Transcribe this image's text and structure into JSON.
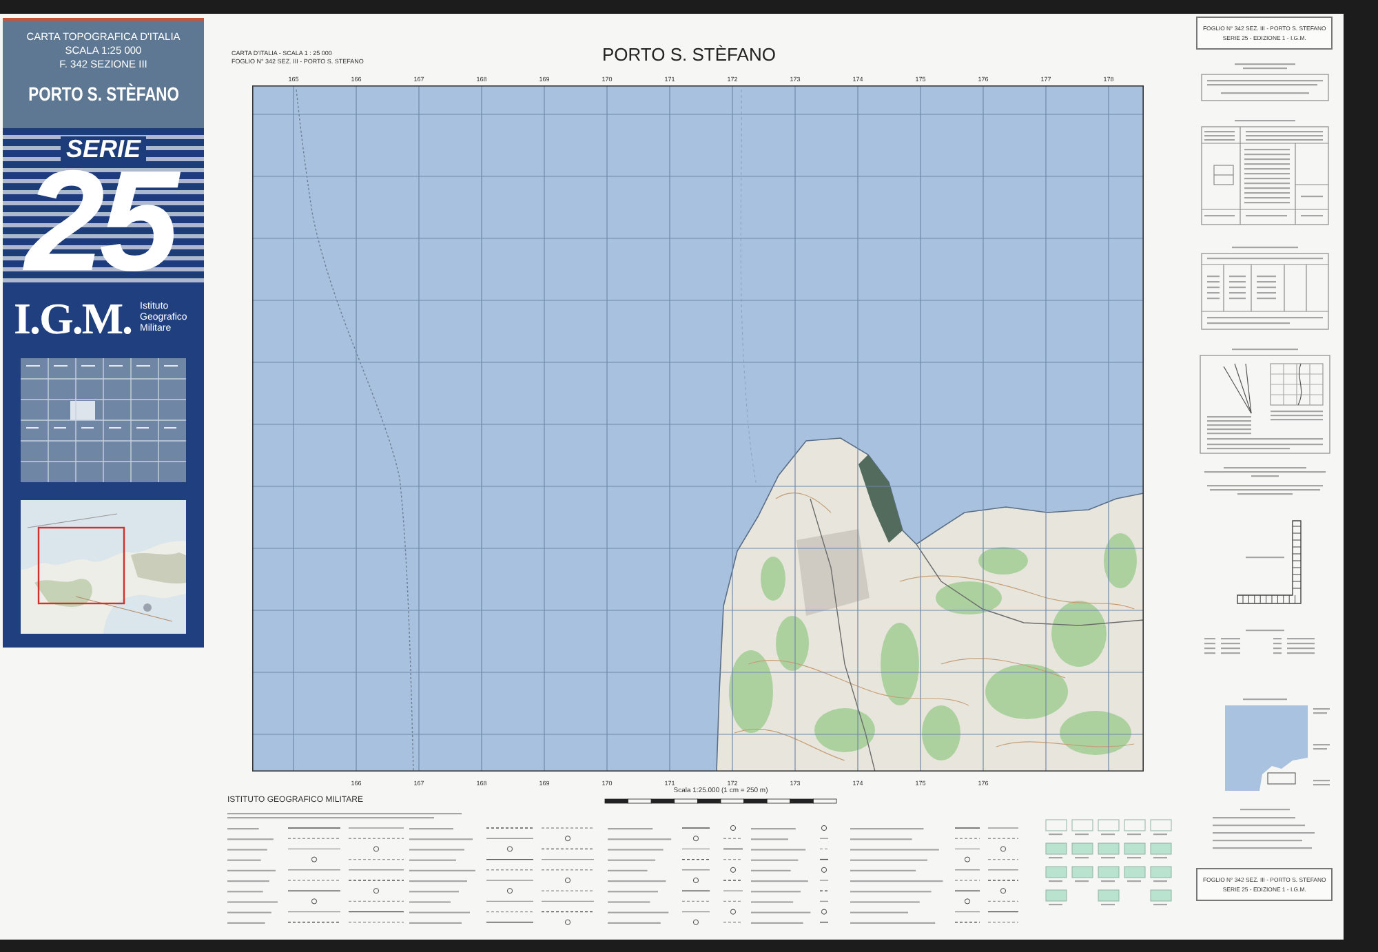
{
  "cover": {
    "heading": "CARTA TOPOGRAFICA D'ITALIA",
    "scale": "SCALA 1:25 000",
    "sheet": "F. 342 SEZIONE III",
    "place": "PORTO S. STÈFANO",
    "series_label": "SERIE",
    "series_number": "25",
    "publisher_mark": "I.G.M.",
    "publisher_name": "Istituto Geografico Militare"
  },
  "header": {
    "series_line": "CARTA D'ITALIA - SCALA 1 : 25 000",
    "sheet_line": "FOGLIO N° 342 SEZ. III - PORTO S. STEFANO",
    "title": "PORTO S. STÈFANO"
  },
  "map": {
    "top_grid_labels": [
      "165",
      "166",
      "167",
      "168",
      "169",
      "170",
      "171",
      "172",
      "173",
      "174",
      "175",
      "176",
      "177",
      "178"
    ],
    "bottom_grid_labels": [
      "166",
      "167",
      "168",
      "169",
      "170",
      "171",
      "172",
      "173",
      "174",
      "175",
      "176"
    ]
  },
  "scale_caption": "Scala 1:25.000 (1 cm = 250 m)",
  "publisher": "ISTITUTO GEOGRAFICO MILITARE",
  "side_panel": {
    "top_box": {
      "sheet_line": "FOGLIO N° 342 SEZ. III - PORTO S. STEFANO",
      "edition_line": "SERIE 25 - EDIZIONE 1 - I.G.M."
    },
    "bottom_box": {
      "sheet_line": "FOGLIO N° 342 SEZ. III - PORTO S. STEFANO",
      "edition_line": "SERIE 25 - EDIZIONE 1 - I.G.M."
    }
  }
}
